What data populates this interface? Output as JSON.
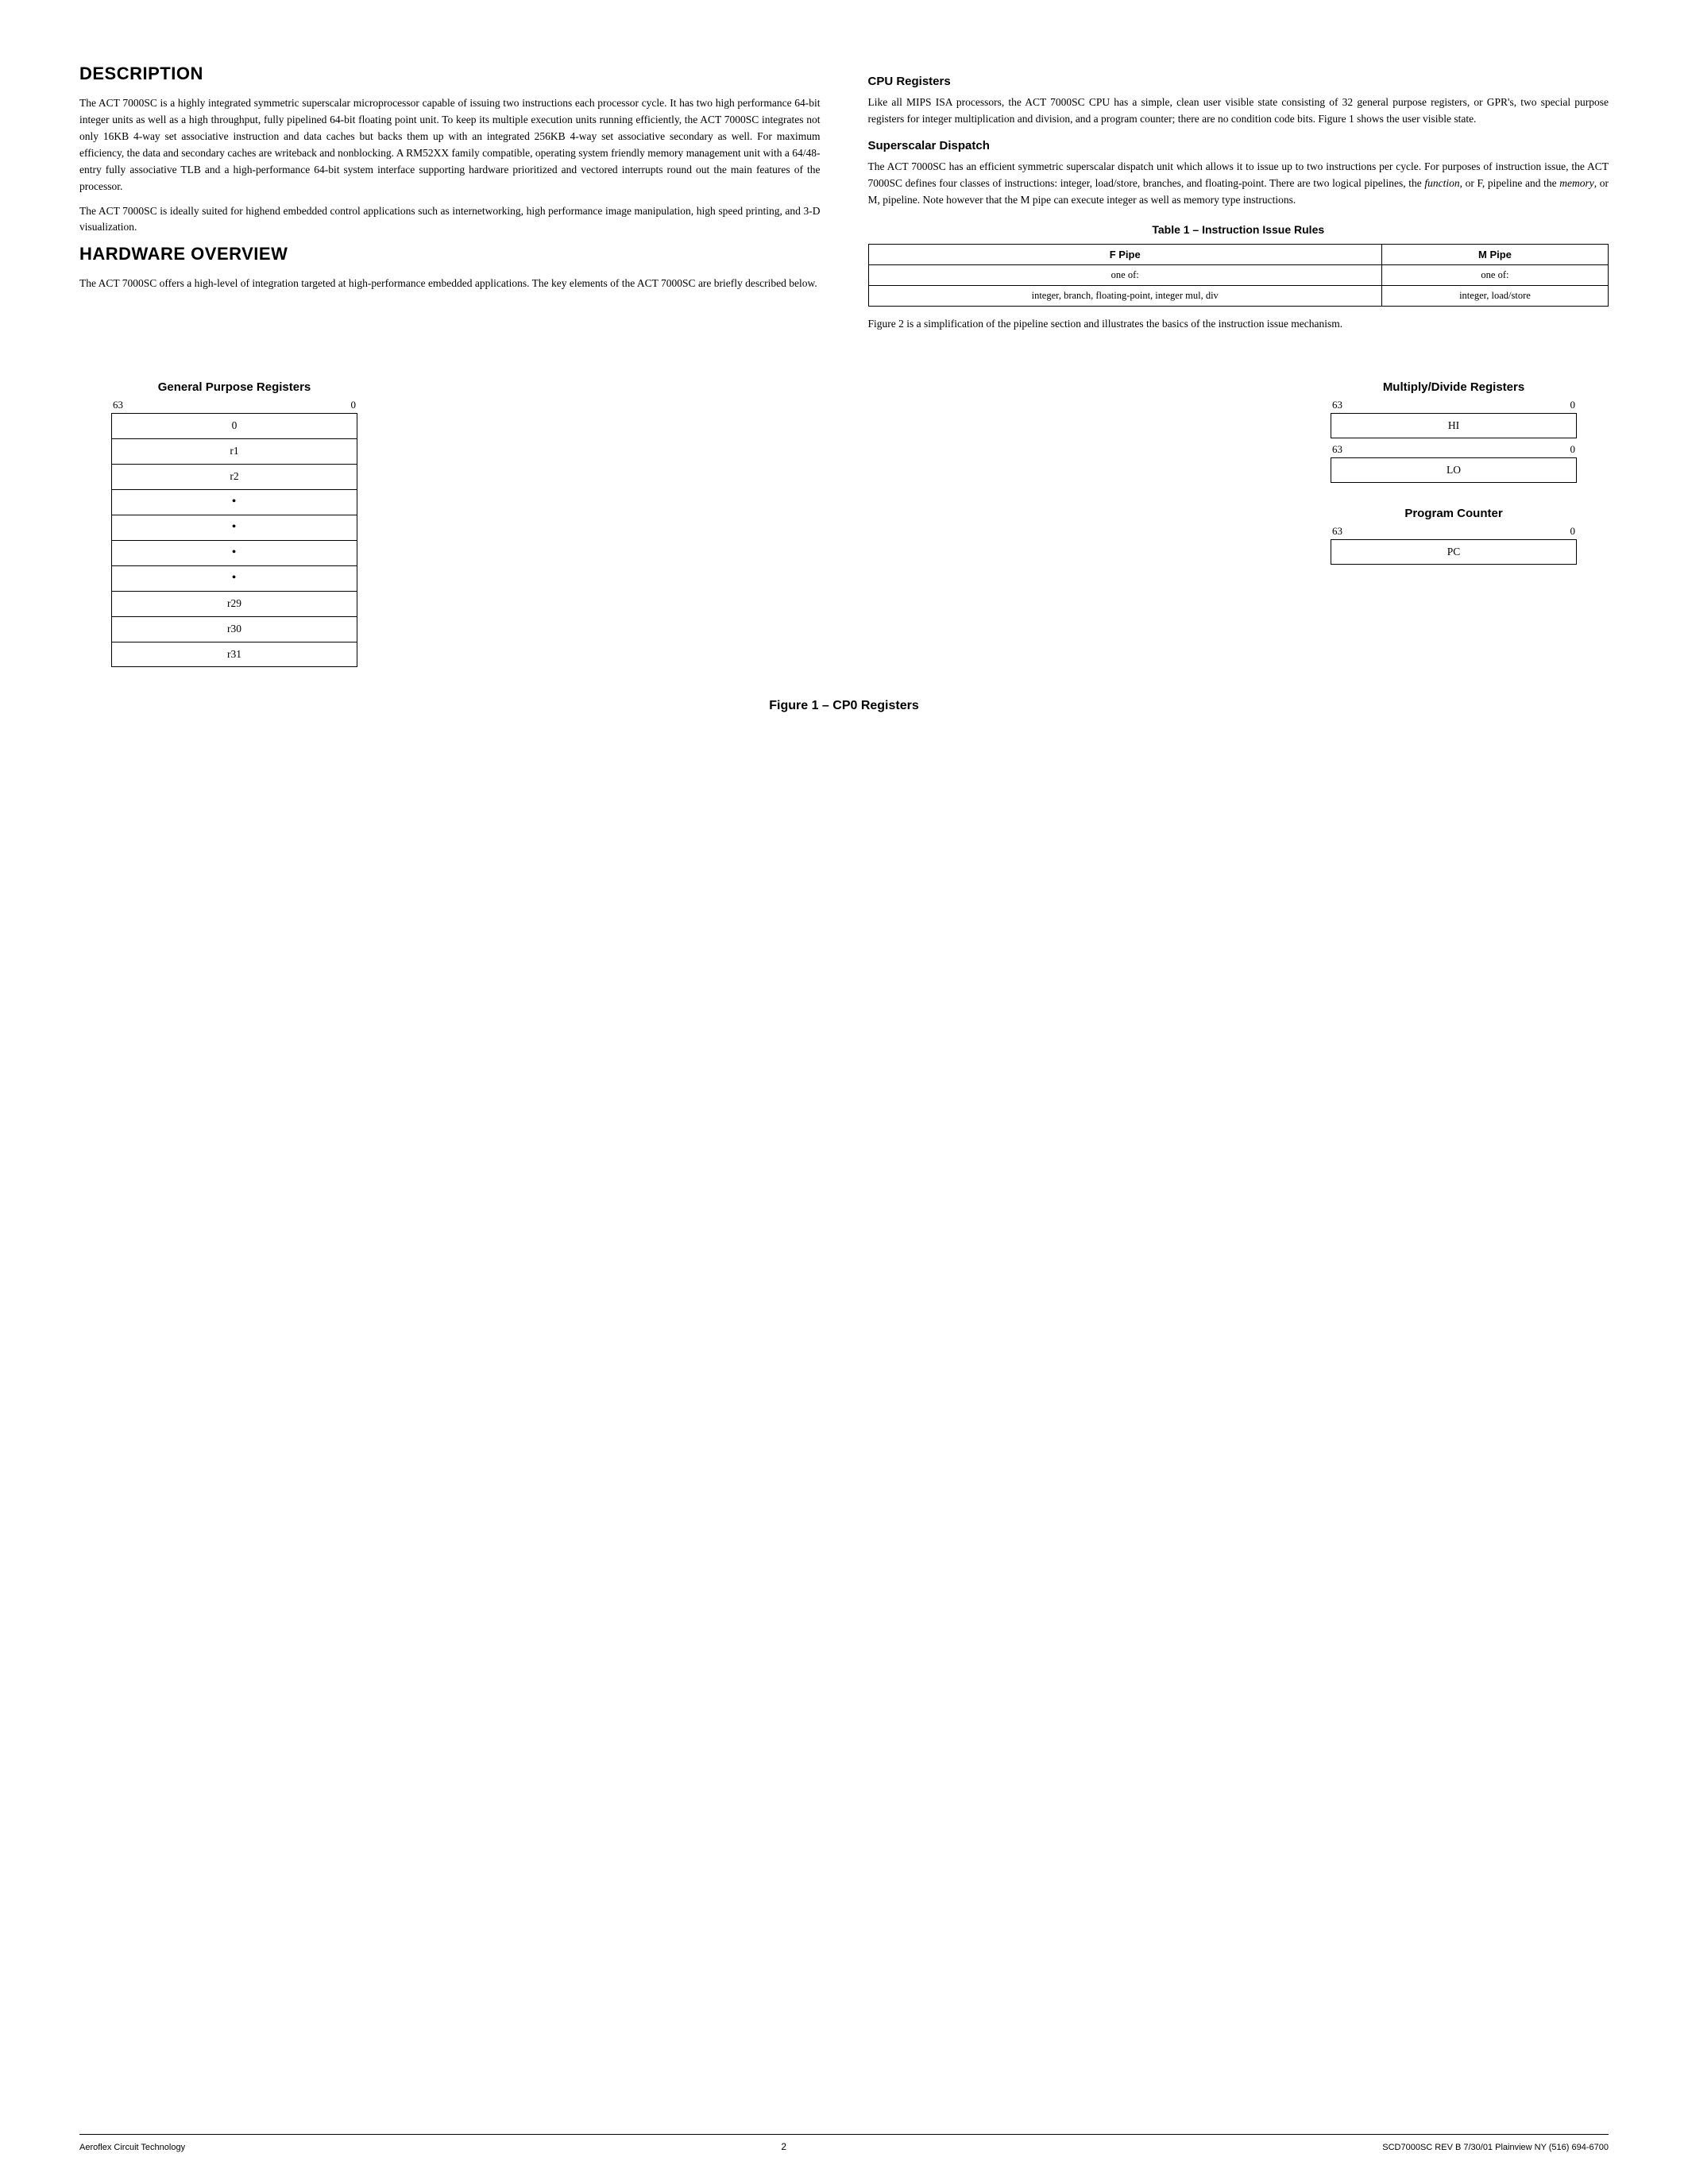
{
  "page": {
    "left_col": {
      "description_title": "DESCRIPTION",
      "description_p1": "The ACT 7000SC is a highly integrated symmetric superscalar microprocessor capable of issuing two instructions each processor cycle. It has two high performance 64-bit integer units as well as a high throughput, fully pipelined 64-bit floating point unit. To keep its multiple execution units running efficiently, the ACT 7000SC integrates not only 16KB 4-way set associative instruction and data caches but backs them up with an integrated 256KB 4-way set associative secondary as well. For maximum efficiency, the data and secondary caches are writeback and nonblocking. A RM52XX family compatible, operating system friendly memory management unit with a 64/48-entry fully associative TLB and a high-performance 64-bit system interface supporting hardware prioritized and vectored interrupts round out the main features of the processor.",
      "description_p2": "The ACT 7000SC is ideally suited for highend embedded control applications such as internetworking, high performance image manipulation, high speed printing, and 3-D visualization.",
      "hardware_title": "HARDWARE OVERVIEW",
      "hardware_p1": "The ACT 7000SC offers a high-level of integration targeted at high-performance embedded applications. The key elements of the ACT 7000SC are briefly described below."
    },
    "right_col": {
      "cpu_title": "CPU Registers",
      "cpu_p1": "Like all MIPS ISA processors, the ACT 7000SC CPU has a simple, clean user visible state consisting of 32 general purpose registers, or GPR's, two special purpose registers for integer multiplication and division, and a program counter; there are no condition code bits. Figure 1 shows the user visible state.",
      "superscalar_title": "Superscalar Dispatch",
      "superscalar_p1": "The ACT 7000SC has an efficient symmetric superscalar dispatch unit which allows it to issue up to two instructions per cycle. For purposes of instruction issue, the ACT 7000SC defines four classes of instructions: integer, load/store, branches, and floating-point. There are two logical pipelines, the function, or F, pipeline and the memory, or M, pipeline. Note however that the M pipe can execute integer as well as memory type instructions.",
      "table_title": "Table 1 – Instruction Issue Rules",
      "table": {
        "headers": [
          "F Pipe",
          "M Pipe"
        ],
        "row1": [
          "one of:",
          "one of:"
        ],
        "row2": [
          "integer, branch, floating-point, integer mul, div",
          "integer, load/store"
        ]
      },
      "figure2_text_p1": "Figure 2 is a simplification of the pipeline section and illustrates the basics of the instruction issue mechanism."
    },
    "figure": {
      "gpr_title": "General Purpose Registers",
      "gpr_bit_high": "63",
      "gpr_bit_low": "0",
      "gpr_rows": [
        "0",
        "r1",
        "r2",
        "•",
        "•",
        "•",
        "•",
        "r29",
        "r30",
        "r31"
      ],
      "md_title": "Multiply/Divide Registers",
      "md_bit_high": "63",
      "md_bit_low": "0",
      "md_rows": [
        "HI",
        "LO"
      ],
      "md_bit_high2": "63",
      "md_bit_low2": "0",
      "pc_title": "Program Counter",
      "pc_bit_high": "63",
      "pc_bit_low": "0",
      "pc_rows": [
        "PC"
      ],
      "caption": "Figure 1 – CP0 Registers"
    },
    "footer": {
      "left": "Aeroflex Circuit Technology",
      "center": "2",
      "right": "SCD7000SC REV B  7/30/01  Plainview NY (516) 694-6700"
    }
  }
}
